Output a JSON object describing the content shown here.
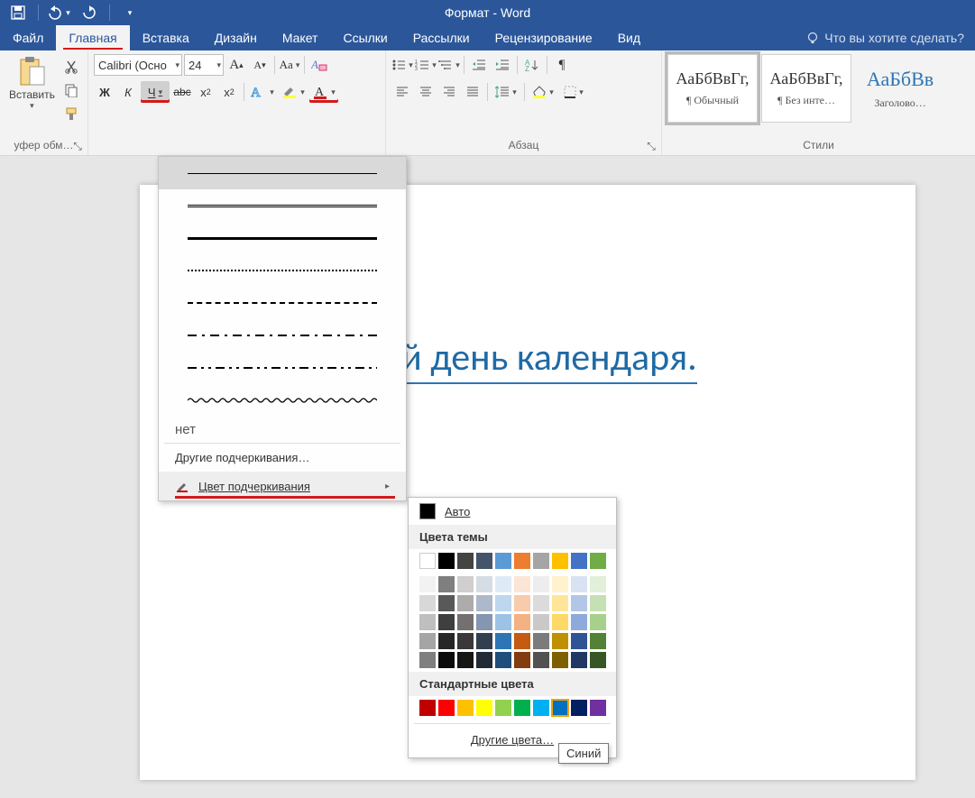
{
  "window": {
    "title": "Формат - Word"
  },
  "tabs": {
    "file": "Файл",
    "home": "Главная",
    "insert": "Вставка",
    "design": "Дизайн",
    "layout": "Макет",
    "references": "Ссылки",
    "mailings": "Рассылки",
    "review": "Рецензирование",
    "view": "Вид",
    "tellme": "Что вы хотите сделать?"
  },
  "clipboard": {
    "paste": "Вставить",
    "group_title": "уфер обм…"
  },
  "font": {
    "name": "Calibri (Осно",
    "size": "24",
    "bold": "Ж",
    "italic": "К",
    "underline": "Ч",
    "strike": "abc",
    "subscript": "x",
    "sub_idx": "2",
    "superscript": "x",
    "sup_idx": "2"
  },
  "paragraph": {
    "group_title": "Абзац"
  },
  "styles": {
    "sample": "АаБбВвГг,",
    "heading_sample": "АаБбВв",
    "s1": "¶ Обычный",
    "s2": "¶ Без инте…",
    "s3": "Заголово…",
    "group_title": "Стили"
  },
  "document": {
    "text": "й день календаря."
  },
  "underline_menu": {
    "none": "нет",
    "more": "Другие подчеркивания…",
    "color": "Цвет подчеркивания"
  },
  "color_menu": {
    "auto": "Авто",
    "theme": "Цвета темы",
    "standard": "Стандартные цвета",
    "more": "Другие цвета…",
    "theme_row1": [
      "#ffffff",
      "#000000",
      "#444444",
      "#44546a",
      "#5b9bd5",
      "#ed7d31",
      "#a5a5a5",
      "#ffc000",
      "#4472c4",
      "#70ad47"
    ],
    "theme_shades": [
      [
        "#f2f2f2",
        "#7f7f7f",
        "#d0cece",
        "#d6dce4",
        "#deebf6",
        "#fbe5d5",
        "#ededed",
        "#fff2cc",
        "#d9e2f3",
        "#e2efd9"
      ],
      [
        "#d8d8d8",
        "#595959",
        "#aeabab",
        "#adb9ca",
        "#bdd7ee",
        "#f7cbac",
        "#dbdbdb",
        "#fee599",
        "#b4c6e7",
        "#c5e0b3"
      ],
      [
        "#bfbfbf",
        "#3f3f3f",
        "#757070",
        "#8496b0",
        "#9cc3e5",
        "#f4b183",
        "#c9c9c9",
        "#ffd965",
        "#8eaadb",
        "#a8d08d"
      ],
      [
        "#a5a5a5",
        "#262626",
        "#3a3838",
        "#323f4f",
        "#2e75b5",
        "#c55a11",
        "#7b7b7b",
        "#bf9000",
        "#2f5496",
        "#538135"
      ],
      [
        "#7f7f7f",
        "#0c0c0c",
        "#171616",
        "#222a35",
        "#1e4e79",
        "#833c0b",
        "#525252",
        "#7f6000",
        "#1f3864",
        "#375623"
      ]
    ],
    "standard_colors": [
      "#c00000",
      "#ff0000",
      "#ffc000",
      "#ffff00",
      "#92d050",
      "#00b050",
      "#00b0f0",
      "#0070c0",
      "#002060",
      "#7030a0"
    ],
    "selected_standard_index": 7
  },
  "tooltip": "Синий"
}
